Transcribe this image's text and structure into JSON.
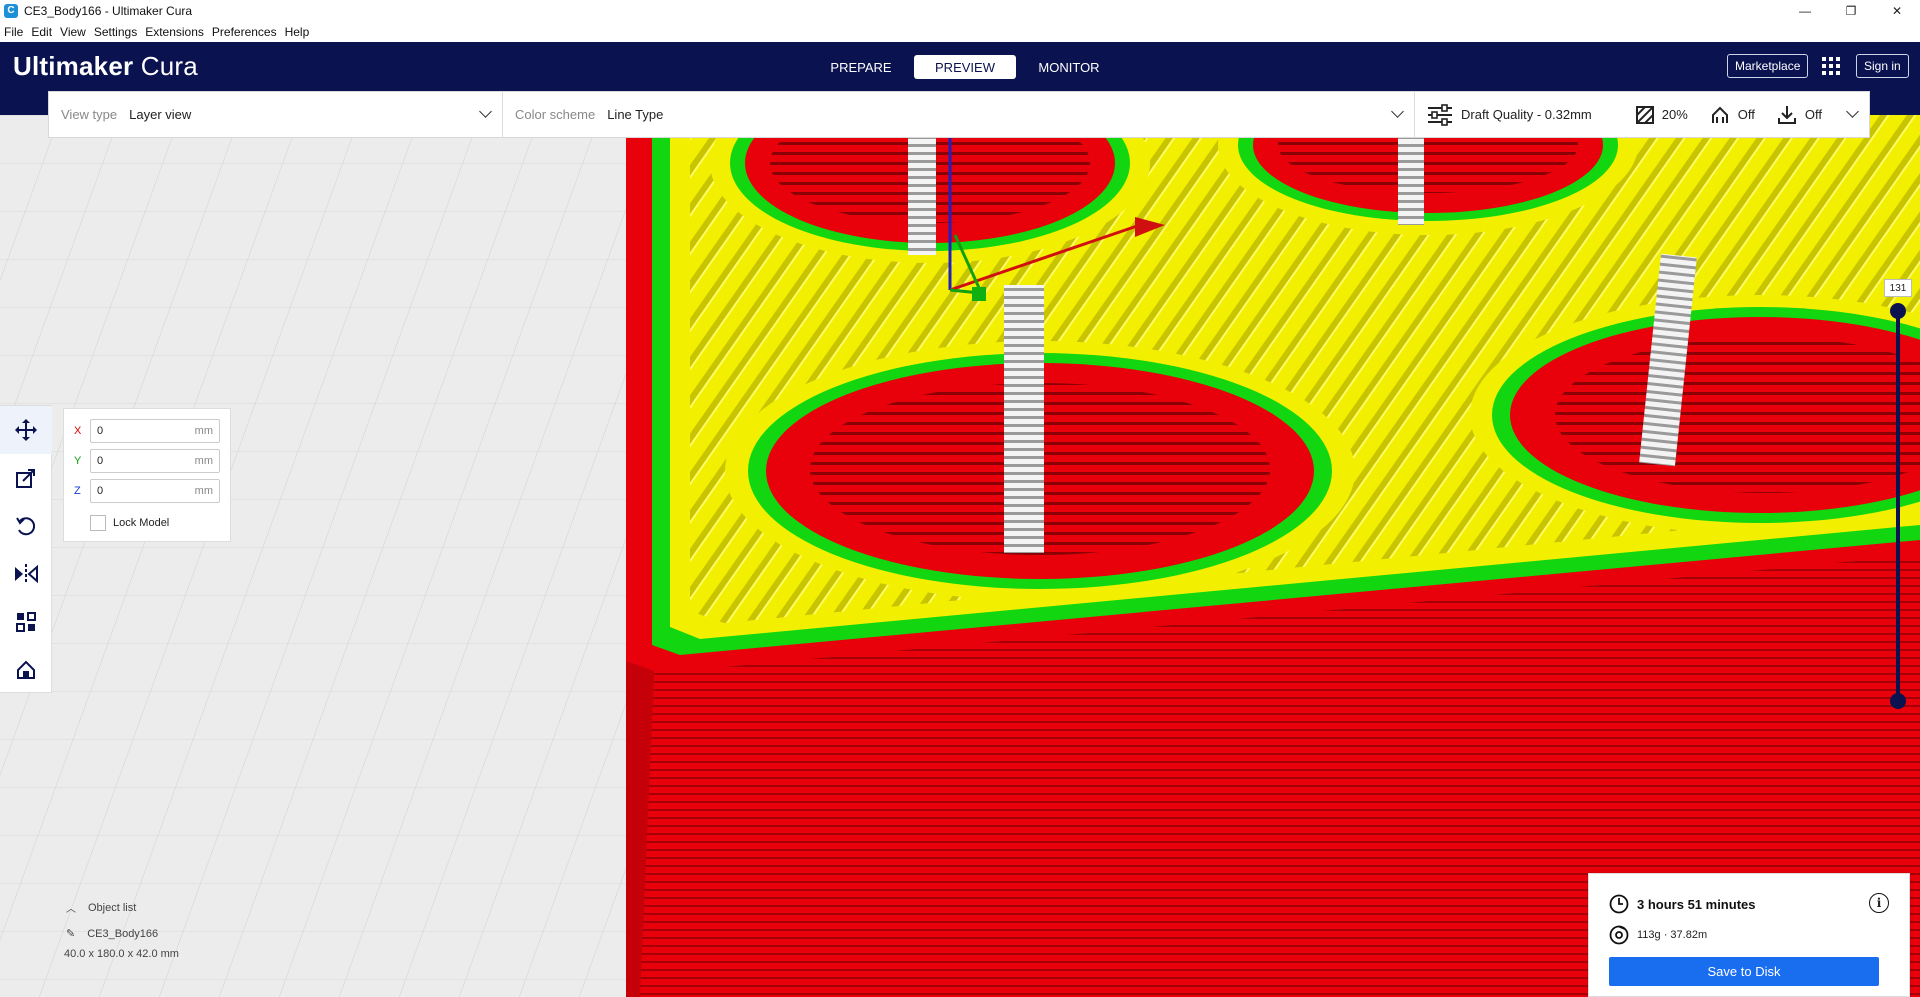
{
  "window": {
    "title": "CE3_Body166 - Ultimaker Cura",
    "minimize": "—",
    "maximize": "❐",
    "close": "✕"
  },
  "menu": [
    "File",
    "Edit",
    "View",
    "Settings",
    "Extensions",
    "Preferences",
    "Help"
  ],
  "header": {
    "brand_bold": "Ultimaker",
    "brand_light": " Cura",
    "tabs": [
      "PREPARE",
      "PREVIEW",
      "MONITOR"
    ],
    "active_tab": "PREVIEW",
    "marketplace": "Marketplace",
    "signin": "Sign in"
  },
  "settings_bar": {
    "view_type_label": "View type",
    "view_type_value": "Layer view",
    "color_scheme_label": "Color scheme",
    "color_scheme_value": "Line Type",
    "profile": "Draft Quality - 0.32mm",
    "infill": "20%",
    "support": "Off",
    "adhesion": "Off"
  },
  "tools": [
    "move-tool",
    "scale-tool",
    "rotate-tool",
    "mirror-tool",
    "per-model-settings-tool",
    "support-blocker-tool"
  ],
  "move_panel": {
    "x_label": "X",
    "x_value": "0",
    "y_label": "Y",
    "y_value": "0",
    "z_label": "Z",
    "z_value": "0",
    "unit": "mm",
    "lock_label": "Lock Model"
  },
  "layer_slider": {
    "current": "131"
  },
  "object_list": {
    "title": "Object list",
    "object_name": "CE3_Body166",
    "dimensions": "40.0 x 180.0 x 42.0 mm"
  },
  "print_info": {
    "time": "3 hours 51 minutes",
    "material": "113g · 37.82m",
    "save_button": "Save to Disk"
  },
  "colors": {
    "header_bg": "#0a1250",
    "wall_outer": "#e8000b",
    "wall_inner": "#12d60f",
    "infill": "#f2f000",
    "accent": "#196ef0"
  }
}
